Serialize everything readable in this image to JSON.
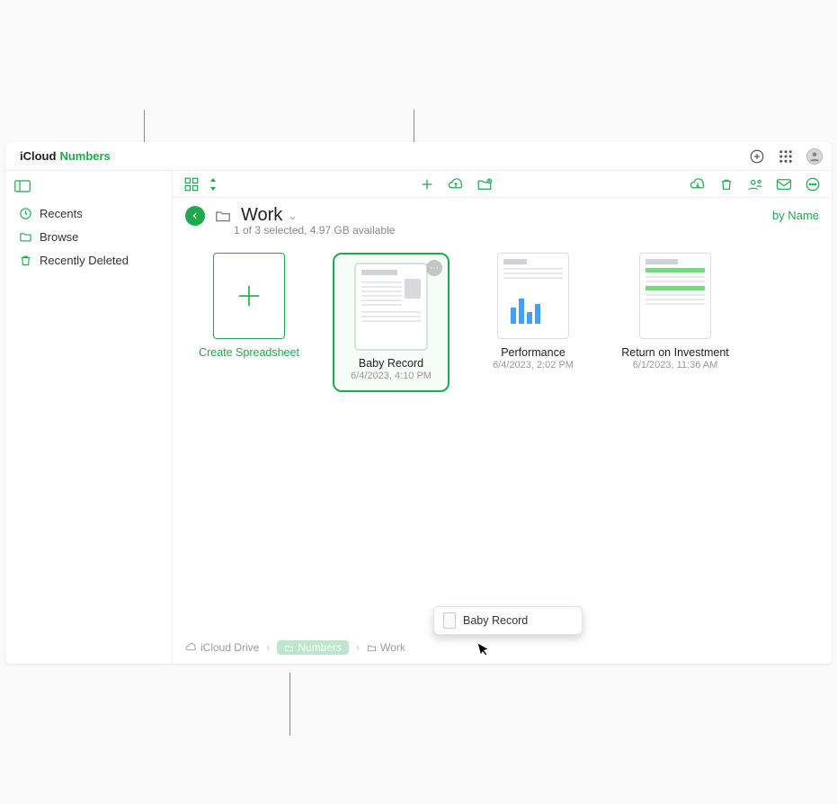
{
  "brand": {
    "product": "Numbers",
    "prefix": "iCloud"
  },
  "sidebar": {
    "items": [
      {
        "label": "Recents"
      },
      {
        "label": "Browse"
      },
      {
        "label": "Recently Deleted"
      }
    ]
  },
  "header": {
    "folder_name": "Work",
    "subtitle": "1 of 3 selected, 4.97 GB available",
    "sort_label": "by Name"
  },
  "grid": {
    "create_label": "Create Spreadsheet",
    "items": [
      {
        "title": "Baby Record",
        "date": "6/4/2023, 4:10 PM",
        "selected": true
      },
      {
        "title": "Performance",
        "date": "6/4/2023, 2:02 PM",
        "selected": false
      },
      {
        "title": "Return on Investment",
        "date": "6/1/2023, 11:36 AM",
        "selected": false
      }
    ]
  },
  "drag": {
    "label": "Baby Record"
  },
  "breadcrumb": {
    "root": "iCloud Drive",
    "mid": "Numbers",
    "leaf": "Work"
  },
  "colors": {
    "accent": "#1fa94c"
  }
}
